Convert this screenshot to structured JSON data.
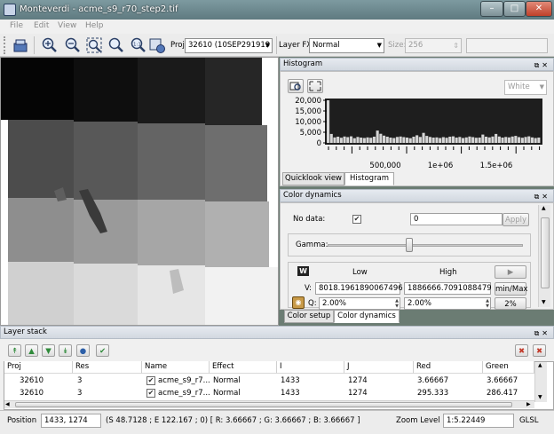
{
  "window": {
    "title": "Monteverdi - acme_s9_r70_step2.tif"
  },
  "menu": [
    "File",
    "Edit",
    "View",
    "Help"
  ],
  "toolbar": {
    "proj_label": "Proj",
    "proj_value": "32610 (10SEP291919",
    "layer_fx_label": "Layer FX",
    "layer_fx_value": "Normal",
    "size_label": "Size:",
    "size_value": "256"
  },
  "histogram": {
    "title": "Histogram",
    "channel_value": "White",
    "y_ticks": [
      "20,000",
      "15,000",
      "10,000",
      "5,000",
      "0"
    ],
    "x_ticks": [
      "500,000",
      "1e+06",
      "1.5e+06"
    ],
    "tabs": [
      "Quicklook view",
      "Histogram"
    ],
    "active_tab": 1,
    "bins": [
      20000,
      4200,
      2600,
      2900,
      2400,
      3000,
      2700,
      3100,
      2200,
      2800,
      2500,
      2300,
      2600,
      2400,
      2900,
      5800,
      4300,
      3400,
      2900,
      2500,
      2300,
      2800,
      3000,
      2700,
      2500,
      2200,
      2900,
      3600,
      2800,
      4700,
      3300,
      2800,
      2500,
      2600,
      2300,
      2700,
      2400,
      2900,
      3100,
      2500,
      2800,
      2300,
      2600,
      3000,
      2700,
      2400,
      2500,
      3900,
      2900,
      2600,
      3000,
      4200,
      3000,
      2500,
      2800,
      2600,
      3000,
      3300,
      2700,
      2400,
      2800,
      3100,
      2600,
      2300,
      2500
    ]
  },
  "color_dynamics": {
    "title": "Color dynamics",
    "nodata_label": "No data:",
    "nodata_checked": true,
    "nodata_value": "0",
    "apply_label": "Apply",
    "gamma_label": "Gamma:",
    "gamma_position": 0.42,
    "channel_badge": "W",
    "low_label": "Low",
    "high_label": "High",
    "v_label": "V:",
    "low_value": "8018.1961890067496",
    "high_value": "1886666.7091088479",
    "minmax_label": "min/Max",
    "q_label": "Q:",
    "low_quantile": "2.00%",
    "high_quantile": "2.00%",
    "preset_label": "2%",
    "tabs": [
      "Color setup",
      "Color dynamics"
    ],
    "active_tab": 1
  },
  "layer_stack": {
    "title": "Layer stack",
    "columns": [
      "Proj",
      "Res",
      "Name",
      "Effect",
      "I",
      "J",
      "Red",
      "Green"
    ],
    "rows": [
      {
        "proj": "32610",
        "res": "3",
        "name": "acme_s9_r7...",
        "effect": "Normal",
        "i": "1433",
        "j": "1274",
        "red": "3.66667",
        "green": "3.66667"
      },
      {
        "proj": "32610",
        "res": "3",
        "name": "acme_s9_r7...",
        "effect": "Normal",
        "i": "1433",
        "j": "1274",
        "red": "295.333",
        "green": "286.417"
      }
    ]
  },
  "status": {
    "position_label": "Position",
    "position_value": "1433, 1274",
    "geo_info": "(S 48.7128 ; E 122.167 ; 0) [ R: 3.66667 ; G: 3.66667 ; B: 3.66667 ]",
    "zoom_label": "Zoom Level",
    "zoom_value": "1:5.22449",
    "glsl_label": "GLSL"
  },
  "colors": {
    "accent": "#3c7fb1",
    "titlebar": "#6e8a90",
    "close": "#c8442e"
  }
}
